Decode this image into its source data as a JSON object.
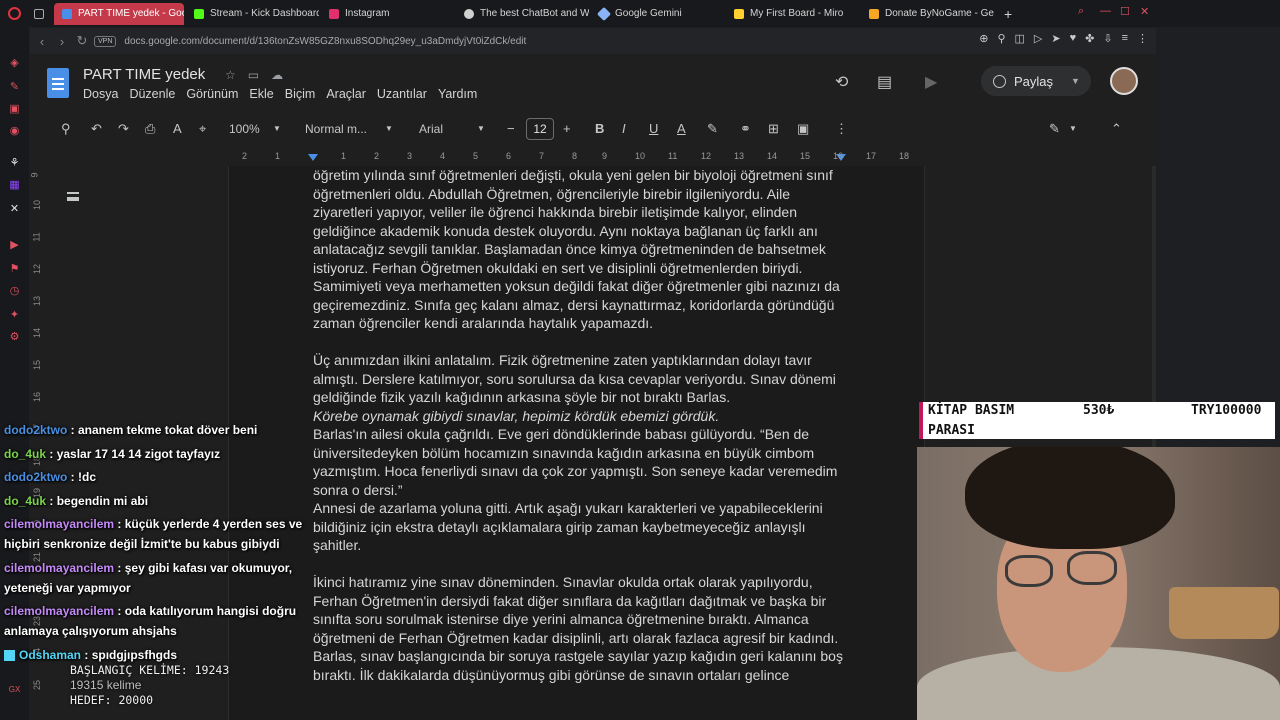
{
  "browser": {
    "tabs": [
      {
        "label": "PART TIME yedek - Goog",
        "color": "#4a8fe7",
        "active": true
      },
      {
        "label": "Stream - Kick Dashboard",
        "color": "#53fc18",
        "active": false
      },
      {
        "label": "Instagram",
        "color": "#e1306c",
        "active": false
      },
      {
        "label": "The best ChatBot and W",
        "color": "#d0d0d0",
        "active": false
      },
      {
        "label": "Google Gemini",
        "color": "#8ab4f8",
        "active": false
      },
      {
        "label": "My First Board - Miro",
        "color": "#ffd02f",
        "active": false
      },
      {
        "label": "Donate ByNoGame - Geic",
        "color": "#f5a623",
        "active": false
      }
    ],
    "vpn_label": "VPN",
    "url": "docs.google.com/document/d/136tonZsW85GZ8nxu8SODhq29ey_u3aDmdyjVt0iZdCk/edit"
  },
  "docs": {
    "title": "PART TIME  yedek",
    "menu": [
      "Dosya",
      "Düzenle",
      "Görünüm",
      "Ekle",
      "Biçim",
      "Araçlar",
      "Uzantılar",
      "Yardım"
    ],
    "share_label": "Paylaş",
    "toolbar": {
      "zoom": "100%",
      "style": "Normal m...",
      "font": "Arial",
      "font_size": "12"
    },
    "ruler_labels": [
      "2",
      "1",
      "1",
      "2",
      "3",
      "4",
      "5",
      "6",
      "7",
      "8",
      "9",
      "10",
      "11",
      "12",
      "13",
      "14",
      "15",
      "16",
      "17",
      "18"
    ],
    "vruler_labels": [
      "9",
      "10",
      "11",
      "12",
      "13",
      "14",
      "15",
      "16",
      "17",
      "18",
      "19",
      "20",
      "21",
      "22",
      "23",
      "24",
      "25"
    ],
    "paragraphs": [
      "öğretim yılında sınıf öğretmenleri değişti, okula yeni gelen bir biyoloji öğretmeni sınıf öğretmenleri oldu. Abdullah Öğretmen, öğrencileriyle birebir ilgileniyordu. Aile ziyaretleri yapıyor, veliler ile öğrenci hakkında birebir iletişimde kalıyor, elinden geldiğince akademik konuda destek oluyordu. Aynı noktaya bağlanan üç farklı anı anlatacağız sevgili tanıklar. Başlamadan önce kimya öğretmeninden de bahsetmek istiyoruz. Ferhan Öğretmen okuldaki en sert ve disiplinli öğretmenlerden biriydi. Samimiyeti veya merhametten yoksun değildi fakat diğer öğretmenler gibi nazınızı da geçiremezdiniz. Sınıfa geç kalanı almaz, dersi kaynattırmaz, koridorlarda göründüğü zaman öğrenciler kendi aralarında haytalık yapamazdı.",
      "Üç anımızdan ilkini anlatalım. Fizik öğretmenine zaten yaptıklarından dolayı tavır almıştı. Derslere katılmıyor, soru sorulursa da kısa cevaplar veriyordu. Sınav dönemi geldiğinde fizik yazılı kağıdının arkasına şöyle bir not bıraktı Barlas.",
      "Körebe oynamak gibiydi sınavlar, hepimiz kördük ebemizi gördük.",
      "Barlas'ın ailesi okula çağrıldı. Eve geri döndüklerinde babası gülüyordu. “Ben de üniversitedeyken bölüm hocamızın sınavında kağıdın arkasına en büyük cimbom yazmıştım. Hoca fenerliydi sınavı da çok zor yapmıştı. Son seneye kadar veremedim sonra o dersi.”",
      "Annesi de azarlama yoluna gitti. Artık aşağı yukarı karakterleri ve yapabileceklerini bildiğiniz için ekstra detaylı açıklamalara girip zaman kaybetmeyeceğiz anlayışlı şahitler.",
      "İkinci hatıramız yine sınav döneminden. Sınavlar okulda ortak olarak yapılıyordu, Ferhan Öğretmen'in dersiydi fakat diğer sınıflara da kağıtları dağıtmak ve başka bir sınıfta soru sorulmak istenirse diye yerini almanca öğretmenine bıraktı. Almanca öğretmeni de Ferhan Öğretmen kadar disiplinli, artı olarak fazlaca agresif bir kadındı. Barlas, sınav başlangıcında bir soruya rastgele sayılar yazıp kağıdın geri kalanını boş bıraktı. İlk dakikalarda düşünüyormuş gibi görünse de sınavın ortaları gelince"
    ]
  },
  "chat": [
    {
      "user": "dodo2ktwo",
      "color": "#4a90e2",
      "text": "ananem tekme tokat döver beni"
    },
    {
      "user": "do_4uk",
      "color": "#7bd44a",
      "text": "yaslar 17 14 14 zigot tayfayız"
    },
    {
      "user": "dodo2ktwo",
      "color": "#4a90e2",
      "text": "!dc"
    },
    {
      "user": "do_4uk",
      "color": "#7bd44a",
      "text": "begendin mi abi"
    },
    {
      "user": "cilemolmayancilem",
      "color": "#c58af9",
      "text": "küçük yerlerde 4 yerden ses ve hiçbiri senkronize değil İzmit'te bu kabus gibiydi"
    },
    {
      "user": "cilemolmayancilem",
      "color": "#c58af9",
      "text": "şey gibi kafası var okumuyor, yeteneği var yapmıyor"
    },
    {
      "user": "cilemolmayancilem",
      "color": "#c58af9",
      "text": "oda katılıyorum hangisi doğru anlamaya çalışıyorum ahsjahs"
    },
    {
      "user": "Odshaman",
      "color": "#53d6f5",
      "text": "spıdgjıpsfhgds",
      "badge": true
    }
  ],
  "counter": {
    "start_label": "BAŞLANGIÇ KELİME: 19243",
    "words": "19315 kelime",
    "goal_label": "HEDEF: 20000"
  },
  "bookfund": {
    "label_line1": "KİTAP BASIM",
    "label_line2": "PARASI",
    "amount": "530₺",
    "goal": "TRY100000"
  }
}
